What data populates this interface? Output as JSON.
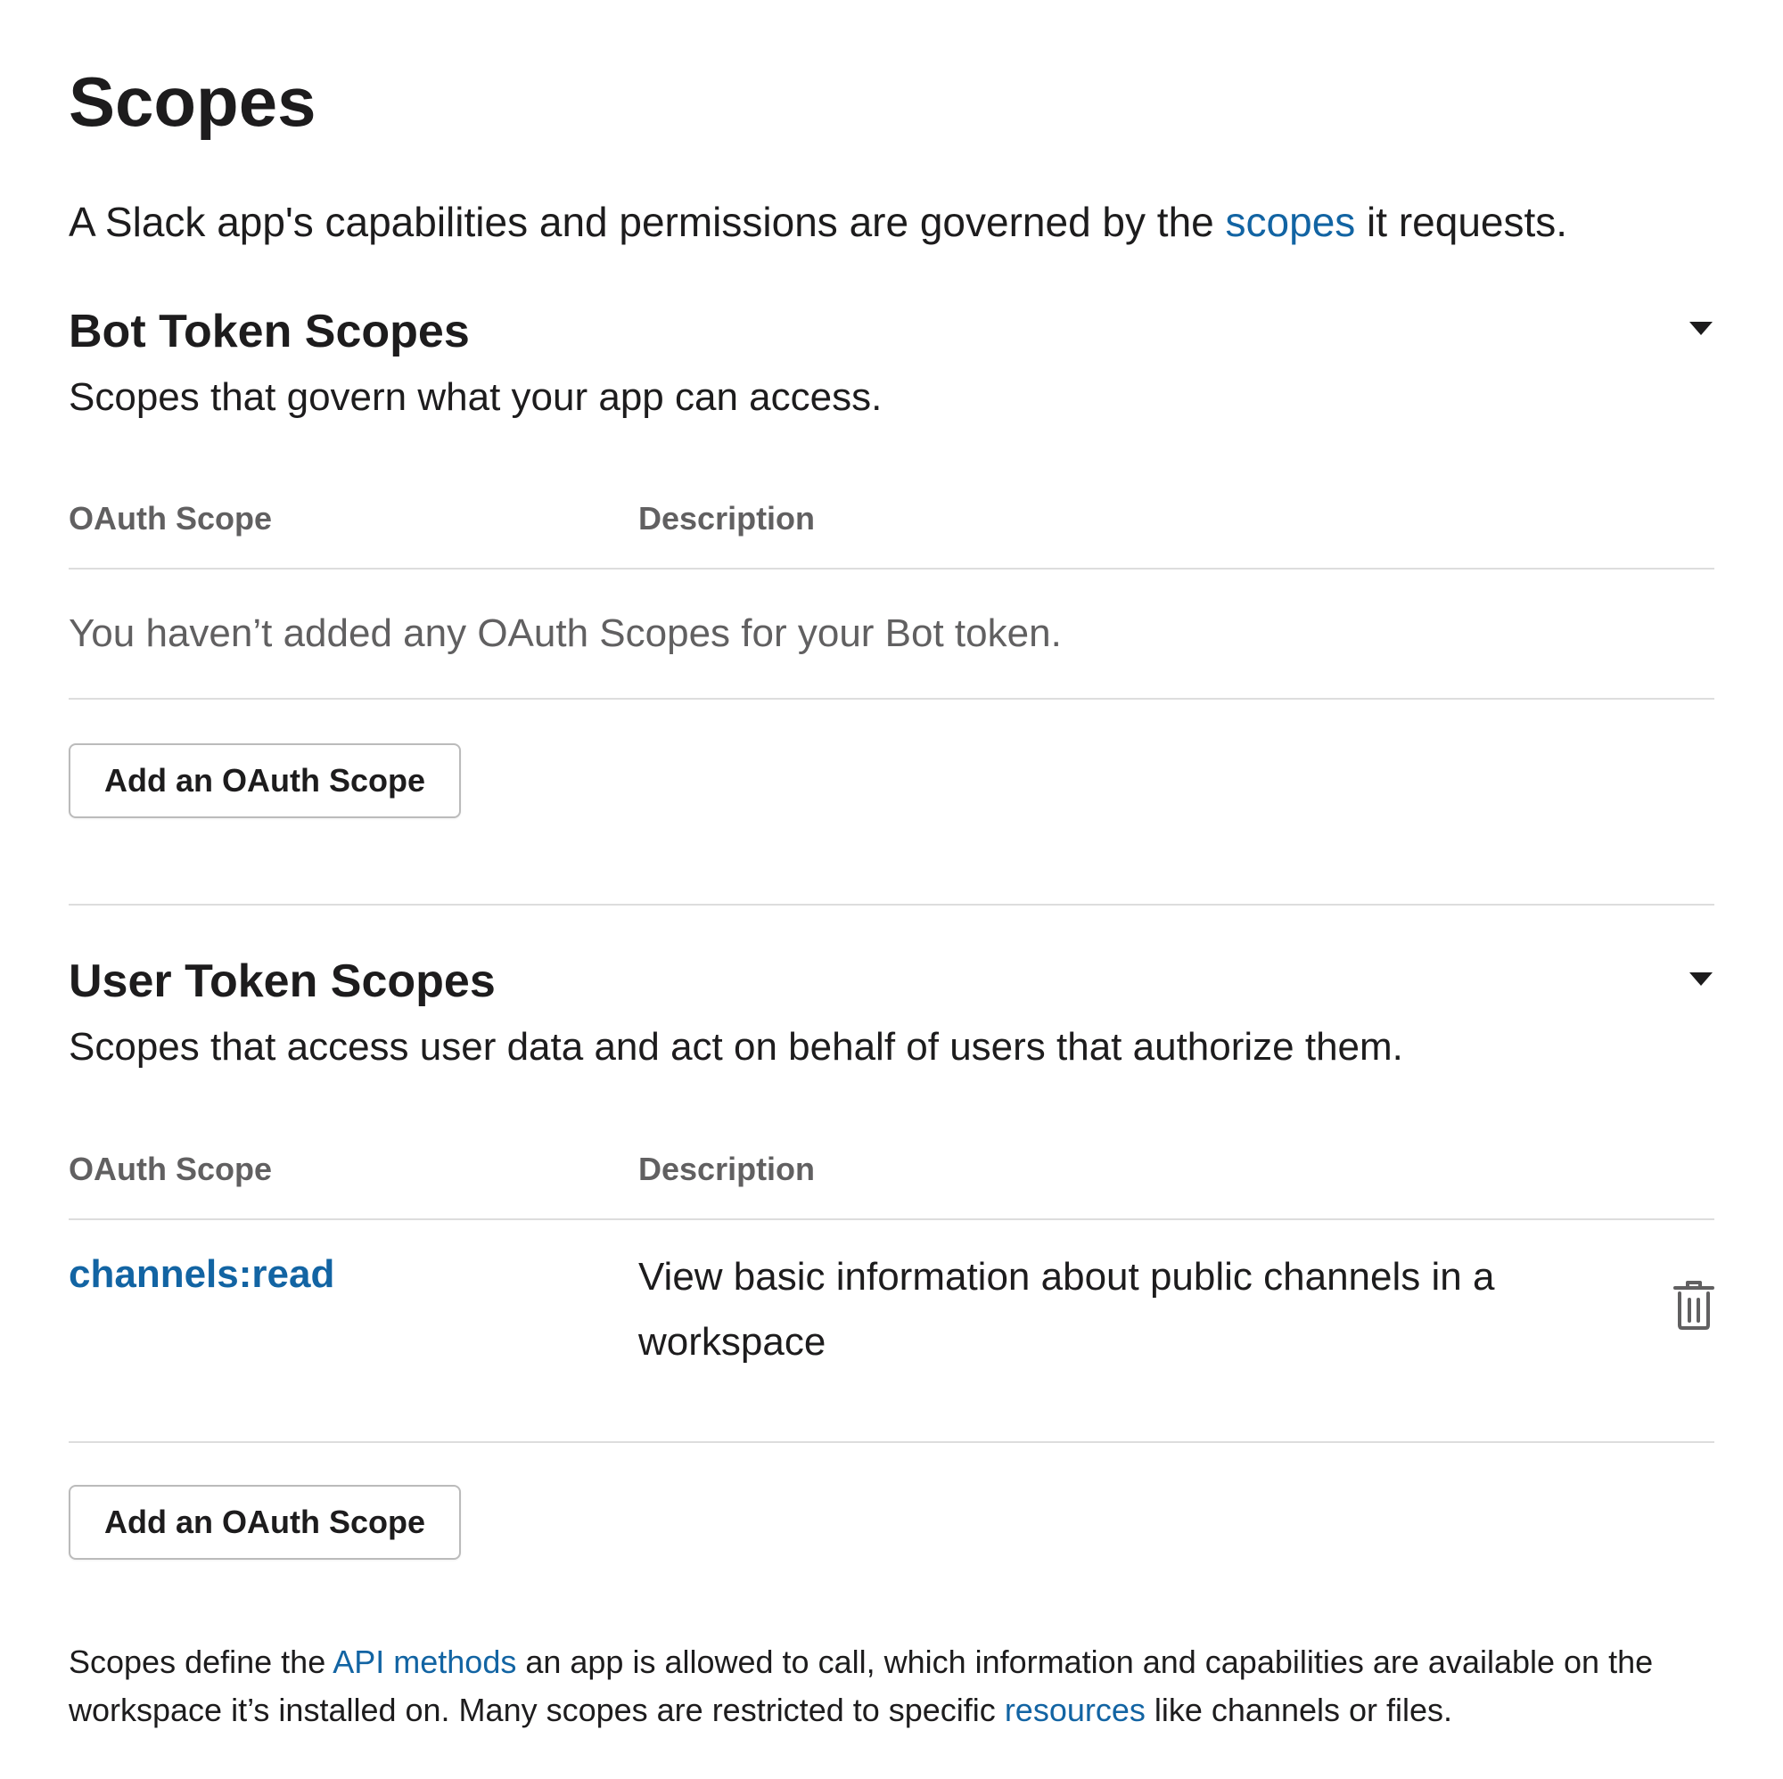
{
  "page": {
    "title": "Scopes",
    "intro_before": "A Slack app's capabilities and permissions are governed by the ",
    "intro_link": "scopes",
    "intro_after": " it requests."
  },
  "bot_section": {
    "title": "Bot Token Scopes",
    "description": "Scopes that govern what your app can access.",
    "toggle_icon": "caret-down-icon",
    "columns": [
      "OAuth Scope",
      "Description"
    ],
    "empty_message": "You haven’t added any OAuth Scopes for your Bot token.",
    "add_button": "Add an OAuth Scope"
  },
  "user_section": {
    "title": "User Token Scopes",
    "description": "Scopes that access user data and act on behalf of users that authorize them.",
    "toggle_icon": "caret-down-icon",
    "columns": [
      "OAuth Scope",
      "Description"
    ],
    "rows": [
      {
        "scope": "channels:read",
        "description": "View basic information about public channels in a workspace",
        "action_icon": "trash-icon"
      }
    ],
    "add_button": "Add an OAuth Scope"
  },
  "footer": {
    "part1": "Scopes define the ",
    "link1": "API methods",
    "part2": " an app is allowed to call, which information and capabilities are available on the workspace it’s installed on. Many scopes are restricted to specific ",
    "link2": "resources",
    "part3": " like channels or files."
  },
  "colors": {
    "link": "#1264a3",
    "text": "#1d1c1d",
    "muted": "#616061",
    "divider": "#dddddd"
  }
}
